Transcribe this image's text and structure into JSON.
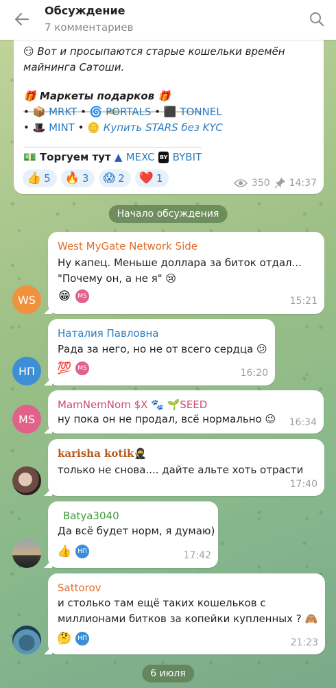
{
  "header": {
    "title": "Обсуждение",
    "subtitle": "7 комментариев"
  },
  "post": {
    "line1": "Вот и просыпаются старые кошельки времён",
    "line2": "майнинга Сатоши.",
    "markets_title": "Маркеты подарков",
    "links_row1": [
      "MRKT",
      "PORTALS",
      "TONNEL"
    ],
    "links_row2": [
      "MINT",
      "Купить STARS без KYC"
    ],
    "trade_label": "Торгуем тут",
    "exchanges": [
      "MEXC",
      "BYBIT"
    ],
    "reactions": [
      {
        "emoji": "👍",
        "count": "5"
      },
      {
        "emoji": "🔥",
        "count": "3"
      },
      {
        "emoji": "😱",
        "count": "2"
      },
      {
        "emoji": "❤️",
        "count": "1"
      }
    ],
    "views": "350",
    "time": "14:37"
  },
  "service": {
    "discussion_start": "Начало обсуждения",
    "date": "6 июля"
  },
  "comments": [
    {
      "name": "West MyGate Network Side",
      "name_color": "#e06d2a",
      "lines": [
        "Ну капец. Меньше доллара за биток отдал...",
        "\"Почему он, а не я\" 😢"
      ],
      "time": "15:21",
      "reaction_emoji": "😁",
      "reactor": "MS",
      "reactor_color": "#e0628a",
      "avatar": "WS",
      "avatar_color": "#f0913e"
    },
    {
      "name": "Наталия Павловна",
      "name_color": "#2a7cc0",
      "lines": [
        "Рада за него, но не от всего сердца 😕"
      ],
      "time": "16:20",
      "reaction_emoji": "💯",
      "reactor": "MS",
      "reactor_color": "#e0628a",
      "avatar": "НП",
      "avatar_color": "#3d8ed6"
    },
    {
      "name": "MamNemNom $X 🐾 🌱SEED",
      "name_color": "#cc4a78",
      "lines": [
        "ну пока он не продал, всё нормально 😉"
      ],
      "time": "16:34",
      "avatar": "MS",
      "avatar_color": "#e0628a"
    },
    {
      "name": "karisha kotik🥷",
      "name_color": "#b55a1e",
      "lines": [
        "только не снова.... дайте альте хоть отрасти"
      ],
      "time": "17:40"
    },
    {
      "name": "Batya3040",
      "name_color": "#3e9a3a",
      "lines": [
        "Да всё будет норм, я думаю)"
      ],
      "time": "17:42",
      "reaction_emoji": "👍",
      "reactor": "НП",
      "reactor_color": "#3d8ed6"
    },
    {
      "name": "Sattorov",
      "name_color": "#e06d2a",
      "lines": [
        "и столько там ещё таких кошельков с",
        "миллионами битков за копейки купленных ? 🙈"
      ],
      "time": "21:23",
      "reaction_emoji": "🤔",
      "reactor": "НП",
      "reactor_color": "#3d8ed6"
    }
  ],
  "colors": {
    "link": "#2a7cc0",
    "reaction_bg": "#e8f1f9",
    "meta": "#a0a0a0"
  }
}
